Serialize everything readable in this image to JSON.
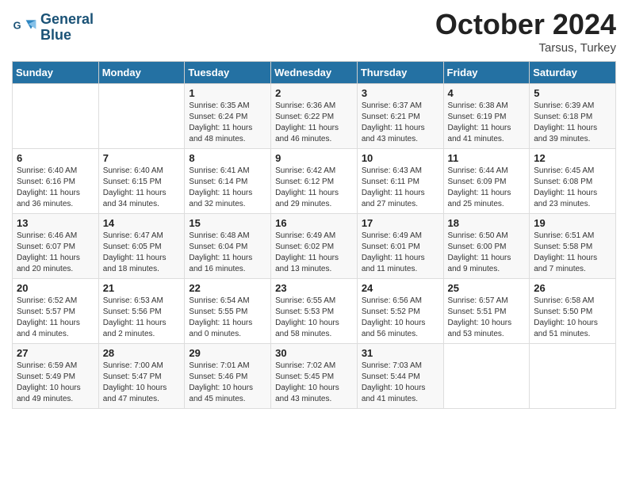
{
  "header": {
    "logo_line1": "General",
    "logo_line2": "Blue",
    "month": "October 2024",
    "location": "Tarsus, Turkey"
  },
  "days_of_week": [
    "Sunday",
    "Monday",
    "Tuesday",
    "Wednesday",
    "Thursday",
    "Friday",
    "Saturday"
  ],
  "weeks": [
    [
      {
        "day": "",
        "sunrise": "",
        "sunset": "",
        "daylight": ""
      },
      {
        "day": "",
        "sunrise": "",
        "sunset": "",
        "daylight": ""
      },
      {
        "day": "1",
        "sunrise": "Sunrise: 6:35 AM",
        "sunset": "Sunset: 6:24 PM",
        "daylight": "Daylight: 11 hours and 48 minutes."
      },
      {
        "day": "2",
        "sunrise": "Sunrise: 6:36 AM",
        "sunset": "Sunset: 6:22 PM",
        "daylight": "Daylight: 11 hours and 46 minutes."
      },
      {
        "day": "3",
        "sunrise": "Sunrise: 6:37 AM",
        "sunset": "Sunset: 6:21 PM",
        "daylight": "Daylight: 11 hours and 43 minutes."
      },
      {
        "day": "4",
        "sunrise": "Sunrise: 6:38 AM",
        "sunset": "Sunset: 6:19 PM",
        "daylight": "Daylight: 11 hours and 41 minutes."
      },
      {
        "day": "5",
        "sunrise": "Sunrise: 6:39 AM",
        "sunset": "Sunset: 6:18 PM",
        "daylight": "Daylight: 11 hours and 39 minutes."
      }
    ],
    [
      {
        "day": "6",
        "sunrise": "Sunrise: 6:40 AM",
        "sunset": "Sunset: 6:16 PM",
        "daylight": "Daylight: 11 hours and 36 minutes."
      },
      {
        "day": "7",
        "sunrise": "Sunrise: 6:40 AM",
        "sunset": "Sunset: 6:15 PM",
        "daylight": "Daylight: 11 hours and 34 minutes."
      },
      {
        "day": "8",
        "sunrise": "Sunrise: 6:41 AM",
        "sunset": "Sunset: 6:14 PM",
        "daylight": "Daylight: 11 hours and 32 minutes."
      },
      {
        "day": "9",
        "sunrise": "Sunrise: 6:42 AM",
        "sunset": "Sunset: 6:12 PM",
        "daylight": "Daylight: 11 hours and 29 minutes."
      },
      {
        "day": "10",
        "sunrise": "Sunrise: 6:43 AM",
        "sunset": "Sunset: 6:11 PM",
        "daylight": "Daylight: 11 hours and 27 minutes."
      },
      {
        "day": "11",
        "sunrise": "Sunrise: 6:44 AM",
        "sunset": "Sunset: 6:09 PM",
        "daylight": "Daylight: 11 hours and 25 minutes."
      },
      {
        "day": "12",
        "sunrise": "Sunrise: 6:45 AM",
        "sunset": "Sunset: 6:08 PM",
        "daylight": "Daylight: 11 hours and 23 minutes."
      }
    ],
    [
      {
        "day": "13",
        "sunrise": "Sunrise: 6:46 AM",
        "sunset": "Sunset: 6:07 PM",
        "daylight": "Daylight: 11 hours and 20 minutes."
      },
      {
        "day": "14",
        "sunrise": "Sunrise: 6:47 AM",
        "sunset": "Sunset: 6:05 PM",
        "daylight": "Daylight: 11 hours and 18 minutes."
      },
      {
        "day": "15",
        "sunrise": "Sunrise: 6:48 AM",
        "sunset": "Sunset: 6:04 PM",
        "daylight": "Daylight: 11 hours and 16 minutes."
      },
      {
        "day": "16",
        "sunrise": "Sunrise: 6:49 AM",
        "sunset": "Sunset: 6:02 PM",
        "daylight": "Daylight: 11 hours and 13 minutes."
      },
      {
        "day": "17",
        "sunrise": "Sunrise: 6:49 AM",
        "sunset": "Sunset: 6:01 PM",
        "daylight": "Daylight: 11 hours and 11 minutes."
      },
      {
        "day": "18",
        "sunrise": "Sunrise: 6:50 AM",
        "sunset": "Sunset: 6:00 PM",
        "daylight": "Daylight: 11 hours and 9 minutes."
      },
      {
        "day": "19",
        "sunrise": "Sunrise: 6:51 AM",
        "sunset": "Sunset: 5:58 PM",
        "daylight": "Daylight: 11 hours and 7 minutes."
      }
    ],
    [
      {
        "day": "20",
        "sunrise": "Sunrise: 6:52 AM",
        "sunset": "Sunset: 5:57 PM",
        "daylight": "Daylight: 11 hours and 4 minutes."
      },
      {
        "day": "21",
        "sunrise": "Sunrise: 6:53 AM",
        "sunset": "Sunset: 5:56 PM",
        "daylight": "Daylight: 11 hours and 2 minutes."
      },
      {
        "day": "22",
        "sunrise": "Sunrise: 6:54 AM",
        "sunset": "Sunset: 5:55 PM",
        "daylight": "Daylight: 11 hours and 0 minutes."
      },
      {
        "day": "23",
        "sunrise": "Sunrise: 6:55 AM",
        "sunset": "Sunset: 5:53 PM",
        "daylight": "Daylight: 10 hours and 58 minutes."
      },
      {
        "day": "24",
        "sunrise": "Sunrise: 6:56 AM",
        "sunset": "Sunset: 5:52 PM",
        "daylight": "Daylight: 10 hours and 56 minutes."
      },
      {
        "day": "25",
        "sunrise": "Sunrise: 6:57 AM",
        "sunset": "Sunset: 5:51 PM",
        "daylight": "Daylight: 10 hours and 53 minutes."
      },
      {
        "day": "26",
        "sunrise": "Sunrise: 6:58 AM",
        "sunset": "Sunset: 5:50 PM",
        "daylight": "Daylight: 10 hours and 51 minutes."
      }
    ],
    [
      {
        "day": "27",
        "sunrise": "Sunrise: 6:59 AM",
        "sunset": "Sunset: 5:49 PM",
        "daylight": "Daylight: 10 hours and 49 minutes."
      },
      {
        "day": "28",
        "sunrise": "Sunrise: 7:00 AM",
        "sunset": "Sunset: 5:47 PM",
        "daylight": "Daylight: 10 hours and 47 minutes."
      },
      {
        "day": "29",
        "sunrise": "Sunrise: 7:01 AM",
        "sunset": "Sunset: 5:46 PM",
        "daylight": "Daylight: 10 hours and 45 minutes."
      },
      {
        "day": "30",
        "sunrise": "Sunrise: 7:02 AM",
        "sunset": "Sunset: 5:45 PM",
        "daylight": "Daylight: 10 hours and 43 minutes."
      },
      {
        "day": "31",
        "sunrise": "Sunrise: 7:03 AM",
        "sunset": "Sunset: 5:44 PM",
        "daylight": "Daylight: 10 hours and 41 minutes."
      },
      {
        "day": "",
        "sunrise": "",
        "sunset": "",
        "daylight": ""
      },
      {
        "day": "",
        "sunrise": "",
        "sunset": "",
        "daylight": ""
      }
    ]
  ]
}
